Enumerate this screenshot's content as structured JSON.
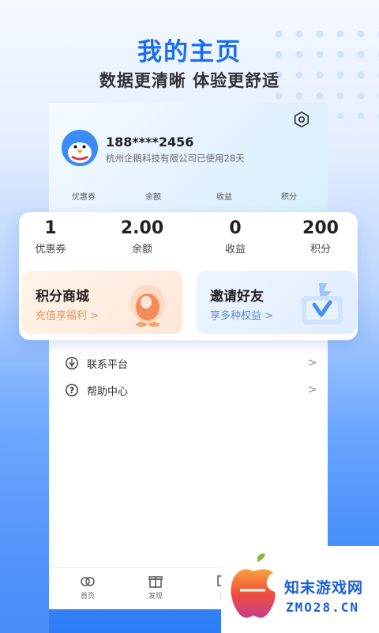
{
  "promo_headline": "我的主页",
  "promo_subheadline": "数据更清晰 体验更舒适",
  "profile": {
    "phone": "188****2456",
    "company_info": "杭州企鹅科技有限公司已使用28天"
  },
  "mini_labels": [
    "优惠券",
    "余额",
    "收益",
    "积分"
  ],
  "stats": [
    {
      "value": "1",
      "label": "优惠券"
    },
    {
      "value": "2.00",
      "label": "余额"
    },
    {
      "value": "0",
      "label": "收益"
    },
    {
      "value": "200",
      "label": "积分"
    }
  ],
  "promos": [
    {
      "title": "积分商城",
      "subtitle": "充值享福利",
      "arrow": ">"
    },
    {
      "title": "邀请好友",
      "subtitle": "享多种权益",
      "arrow": ">"
    }
  ],
  "menu": [
    {
      "label": "联系平台",
      "icon": "contact-platform-icon",
      "arrow": ">"
    },
    {
      "label": "帮助中心",
      "icon": "help-circle-icon",
      "arrow": ">"
    }
  ],
  "tabs": [
    {
      "label": "首页",
      "icon": "home-icon"
    },
    {
      "label": "发现",
      "icon": "gift-icon"
    },
    {
      "label": "消",
      "icon": "message-icon"
    }
  ],
  "watermark": {
    "name": "知末游戏网",
    "domain": "ZMO28.CN"
  },
  "colors": {
    "accent": "#1b6ef3",
    "mall_subtitle": "#e8925a",
    "invite_subtitle": "#5a8fd8"
  }
}
